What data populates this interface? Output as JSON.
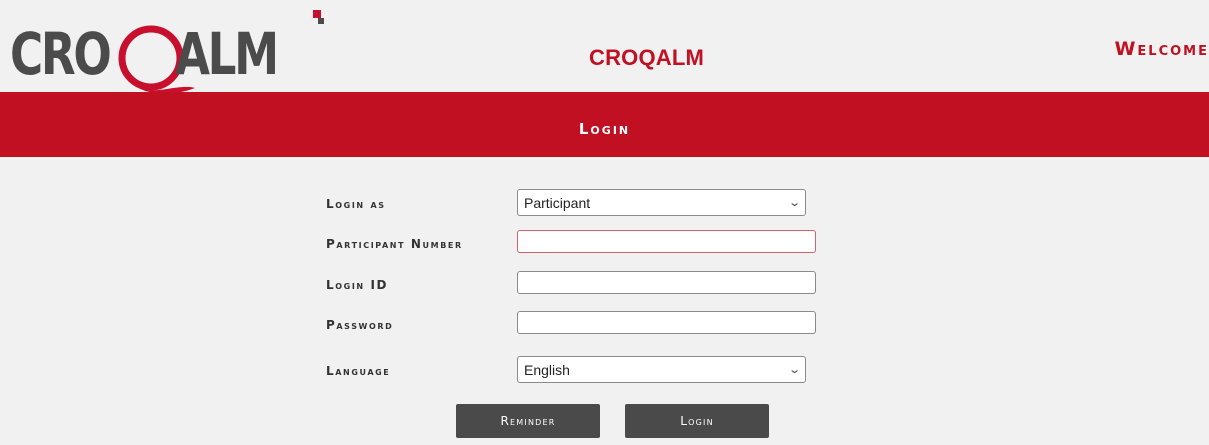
{
  "header": {
    "logo_left": "CRO",
    "logo_right": "ALM",
    "site_title": "CROQALM",
    "welcome": "Welcome"
  },
  "band": {
    "title": "Login"
  },
  "form": {
    "login_as": {
      "label": "Login as",
      "selected": "Participant"
    },
    "participant_number": {
      "label": "Participant Number",
      "value": ""
    },
    "login_id": {
      "label": "Login ID",
      "value": ""
    },
    "password": {
      "label": "Password",
      "value": ""
    },
    "language": {
      "label": "Language",
      "selected": "English"
    }
  },
  "buttons": {
    "reminder": "Reminder",
    "login": "Login"
  },
  "colors": {
    "brand_red": "#c11022",
    "logo_gray": "#4b4b4b",
    "button_gray": "#4a4a4a"
  }
}
